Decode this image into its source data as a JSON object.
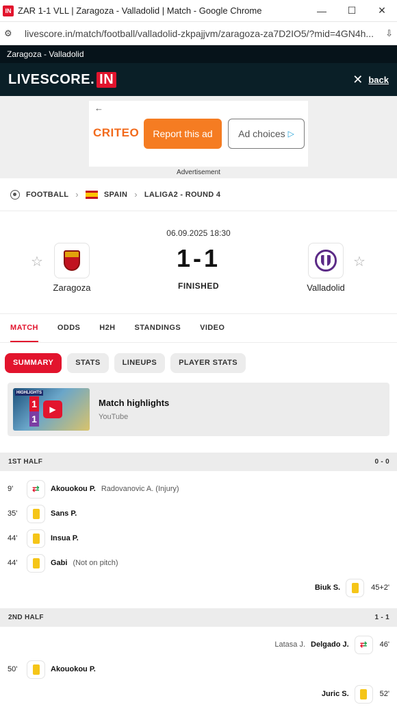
{
  "browser": {
    "favicon": "IN",
    "window_title": "ZAR 1-1 VLL | Zaragoza - Valladolid | Match - Google Chrome",
    "url": "livescore.in/match/football/valladolid-zkpajjvm/zaragoza-za7D2IO5/?mid=4GN4h..."
  },
  "site": {
    "top_crumb": "Zaragoza - Valladolid",
    "logo_main": "LIVESCORE.",
    "logo_badge": "IN",
    "back_label": "back"
  },
  "ad": {
    "brand": "CRITEO",
    "report_label": "Report this ad",
    "choices_label": "Ad choices",
    "caption": "Advertisement"
  },
  "breadcrumbs": {
    "sport": "FOOTBALL",
    "country": "SPAIN",
    "league": "LALIGA2 - ROUND 4"
  },
  "match": {
    "datetime": "06.09.2025 18:30",
    "score": "1-1",
    "status": "FINISHED",
    "home": "Zaragoza",
    "away": "Valladolid"
  },
  "tabs": [
    "MATCH",
    "ODDS",
    "H2H",
    "STANDINGS",
    "VIDEO"
  ],
  "subtabs": [
    "SUMMARY",
    "STATS",
    "LINEUPS",
    "PLAYER STATS"
  ],
  "highlights": {
    "thumb_label": "HIGHLIGHTS",
    "thumb_home": "1",
    "thumb_away": "1",
    "title": "Match highlights",
    "source": "YouTube"
  },
  "first_half": {
    "label": "1ST HALF",
    "score": "0 - 0",
    "events": [
      {
        "minute": "9'",
        "type": "substitution",
        "player": "Akouokou P.",
        "note": "Radovanovic A. (Injury)",
        "side": "home"
      },
      {
        "minute": "35'",
        "type": "yellow-card",
        "player": "Sans P.",
        "note": "",
        "side": "home"
      },
      {
        "minute": "44'",
        "type": "yellow-card",
        "player": "Insua P.",
        "note": "",
        "side": "home"
      },
      {
        "minute": "44'",
        "type": "yellow-card",
        "player": "Gabi",
        "note": "(Not on pitch)",
        "side": "home"
      },
      {
        "minute": "45+2'",
        "type": "yellow-card",
        "player": "Biuk S.",
        "note": "",
        "side": "away"
      }
    ]
  },
  "second_half": {
    "label": "2ND HALF",
    "score": "1 - 1",
    "events": [
      {
        "minute": "46'",
        "type": "substitution",
        "player": "Delgado J.",
        "note": "Latasa J.",
        "side": "away"
      },
      {
        "minute": "50'",
        "type": "yellow-card",
        "player": "Akouokou P.",
        "note": "",
        "side": "home"
      },
      {
        "minute": "52'",
        "type": "yellow-card",
        "player": "Juric S.",
        "note": "",
        "side": "away"
      }
    ]
  },
  "colors": {
    "accent": "#e2142d",
    "header_bg": "#0a1f27",
    "yellow_card": "#f5c518"
  }
}
